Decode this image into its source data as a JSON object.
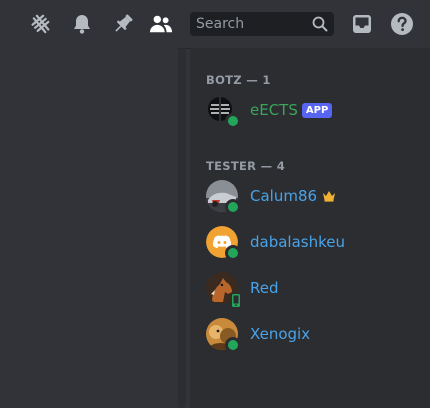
{
  "search": {
    "placeholder": "Search"
  },
  "toolbar": {
    "icons": [
      "threads-icon",
      "bell-icon",
      "pin-icon",
      "members-icon",
      "inbox-icon",
      "help-icon"
    ]
  },
  "members": {
    "sections": [
      {
        "header": "BOTZ — 1",
        "items": [
          {
            "name": "eECTS",
            "badge": "APP",
            "status": "online",
            "color": "#3ba55c"
          }
        ]
      },
      {
        "header": "TESTER — 4",
        "items": [
          {
            "name": "Calum86",
            "crown": true,
            "status": "online",
            "color": "#4aa3e8"
          },
          {
            "name": "dabalashkeu",
            "status": "online",
            "color": "#4aa3e8"
          },
          {
            "name": "Red",
            "status": "mobile",
            "color": "#4aa3e8"
          },
          {
            "name": "Xenogix",
            "status": "online",
            "color": "#4aa3e8"
          }
        ]
      }
    ]
  },
  "colors": {
    "background": "#313338",
    "sidebar": "#2b2d31",
    "online": "#23a55a",
    "accent": "#5865f2",
    "crown": "#f0b232"
  }
}
